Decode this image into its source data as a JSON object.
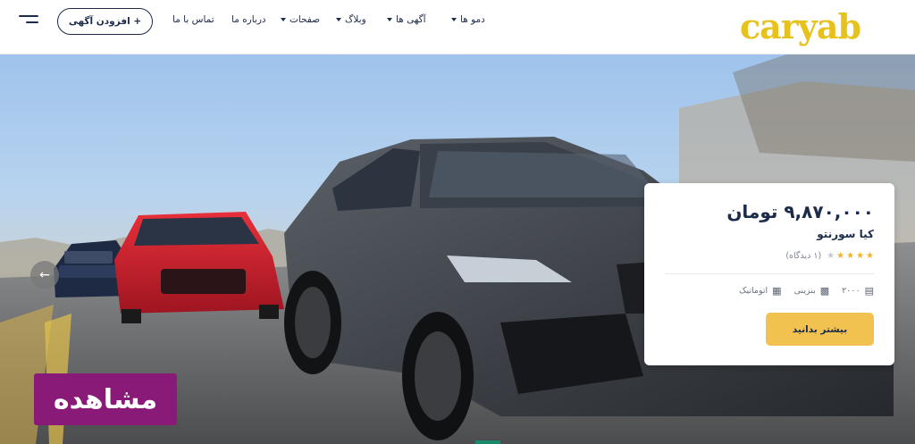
{
  "header": {
    "logo": "caryab",
    "nav": [
      {
        "label": "دمو ها",
        "has_dropdown": true
      },
      {
        "label": "آگهی ها",
        "has_dropdown": true
      },
      {
        "label": "وبلاگ",
        "has_dropdown": true
      },
      {
        "label": "صفحات",
        "has_dropdown": true
      },
      {
        "label": "درباره ما",
        "has_dropdown": false
      },
      {
        "label": "تماس با ما",
        "has_dropdown": false
      }
    ],
    "add_button": "+ افزودن آگهی",
    "menu_icon": "hamburger-icon"
  },
  "card": {
    "price": "۹,۸۷۰,۰۰۰ تومان",
    "name": "کیا سورنتو",
    "rating": {
      "stars": 4,
      "max": 5,
      "label": "(۱ دیدگاه)"
    },
    "specs": [
      {
        "icon": "calendar-icon",
        "value": "۲۰۰۰"
      },
      {
        "icon": "fuel-icon",
        "value": "بنزینی"
      },
      {
        "icon": "gearbox-icon",
        "value": "اتوماتیک"
      }
    ],
    "button": "بیشتر بدانید"
  },
  "slider": {
    "prev_icon": "arrow-left-icon",
    "next_icon": "arrow-right-icon"
  },
  "badge": "مشاهده",
  "colors": {
    "brand_yellow": "#e8c21c",
    "button_yellow": "#f2c250",
    "navy": "#1c2b49",
    "badge_purple": "#8a1a77"
  }
}
